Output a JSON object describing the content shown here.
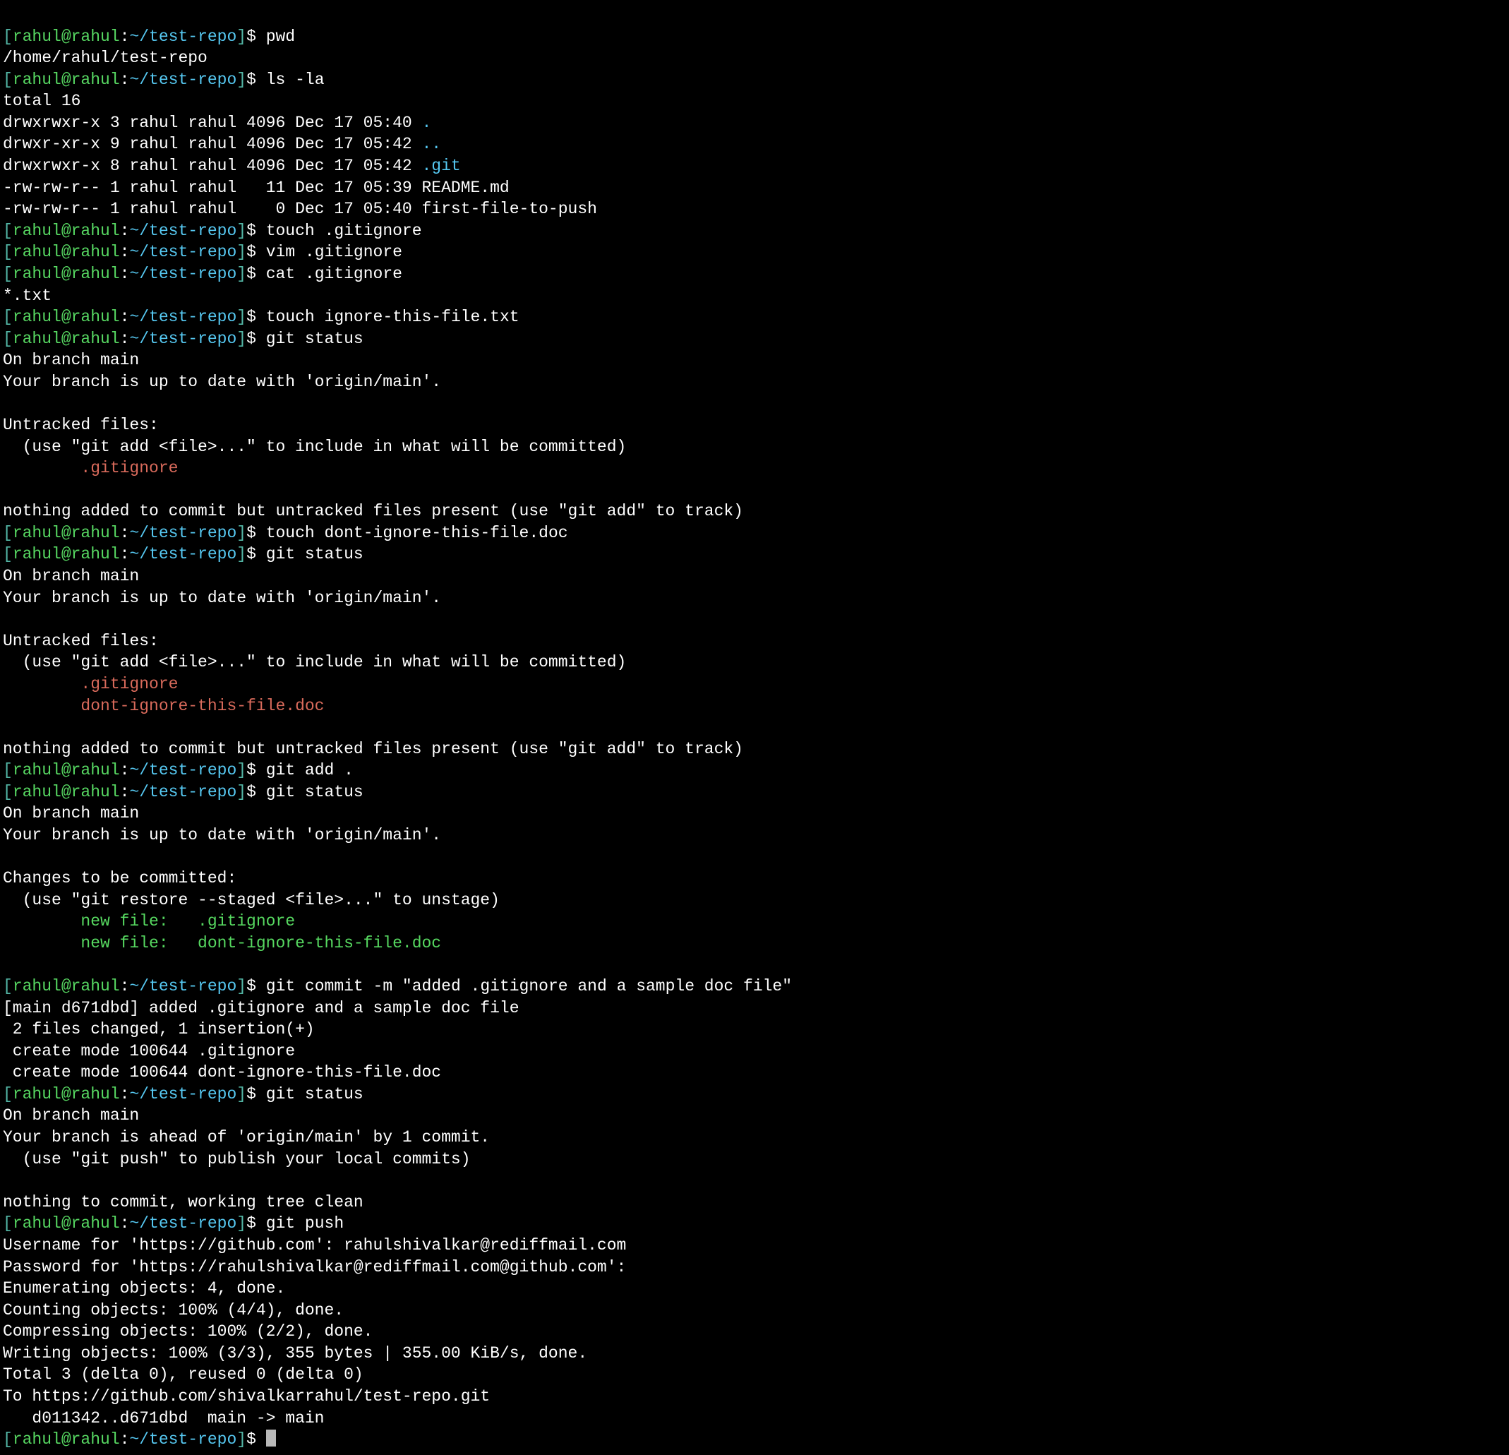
{
  "colors": {
    "bg": "#000000",
    "fg": "#ffffff",
    "user": "#57d862",
    "path": "#56c8f1",
    "red": "#d86a5b",
    "green": "#56d860",
    "teal": "#54b8a7"
  },
  "prompt": {
    "user": "rahul@rahul",
    "sep": ":",
    "path": "~/test-repo",
    "end": "$ ",
    "open_bracket": "[",
    "close_bracket": "]"
  },
  "lines": {
    "cmd_pwd": "pwd",
    "out_pwd": "/home/rahul/test-repo",
    "cmd_ls": "ls -la",
    "ls_total": "total 16",
    "ls_row1_a": "drwxrwxr-x 3 rahul rahul 4096 Dec 17 05:40 ",
    "ls_row1_b": ".",
    "ls_row2_a": "drwxr-xr-x 9 rahul rahul 4096 Dec 17 05:42 ",
    "ls_row2_b": "..",
    "ls_row3_a": "drwxrwxr-x 8 rahul rahul 4096 Dec 17 05:42 ",
    "ls_row3_b": ".git",
    "ls_row4": "-rw-rw-r-- 1 rahul rahul   11 Dec 17 05:39 README.md",
    "ls_row5": "-rw-rw-r-- 1 rahul rahul    0 Dec 17 05:40 first-file-to-push",
    "cmd_touch1": "touch .gitignore",
    "cmd_vim": "vim .gitignore",
    "cmd_cat": "cat .gitignore",
    "out_cat": "*.txt",
    "cmd_touch2": "touch ignore-this-file.txt",
    "cmd_status1": "git status",
    "st_branch": "On branch main",
    "st_uptodate": "Your branch is up to date with 'origin/main'.",
    "st_untracked_hdr": "Untracked files:",
    "st_untracked_hint": "  (use \"git add <file>...\" to include in what will be committed)",
    "st_untracked_f1": "        .gitignore",
    "st_nothing_added": "nothing added to commit but untracked files present (use \"git add\" to track)",
    "cmd_touch3": "touch dont-ignore-this-file.doc",
    "cmd_status2": "git status",
    "st_untracked_f2": "        dont-ignore-this-file.doc",
    "cmd_add": "git add .",
    "cmd_status3": "git status",
    "st_changes_hdr": "Changes to be committed:",
    "st_changes_hint": "  (use \"git restore --staged <file>...\" to unstage)",
    "st_newfile1": "        new file:   .gitignore",
    "st_newfile2": "        new file:   dont-ignore-this-file.doc",
    "cmd_commit": "git commit -m \"added .gitignore and a sample doc file\"",
    "commit_out1": "[main d671dbd] added .gitignore and a sample doc file",
    "commit_out2": " 2 files changed, 1 insertion(+)",
    "commit_out3": " create mode 100644 .gitignore",
    "commit_out4": " create mode 100644 dont-ignore-this-file.doc",
    "cmd_status4": "git status",
    "st_ahead": "Your branch is ahead of 'origin/main' by 1 commit.",
    "st_push_hint": "  (use \"git push\" to publish your local commits)",
    "st_clean": "nothing to commit, working tree clean",
    "cmd_push": "git push",
    "push_user": "Username for 'https://github.com': rahulshivalkar@rediffmail.com",
    "push_pass": "Password for 'https://rahulshivalkar@rediffmail.com@github.com': ",
    "push_enum": "Enumerating objects: 4, done.",
    "push_count": "Counting objects: 100% (4/4), done.",
    "push_compress": "Compressing objects: 100% (2/2), done.",
    "push_write": "Writing objects: 100% (3/3), 355 bytes | 355.00 KiB/s, done.",
    "push_total": "Total 3 (delta 0), reused 0 (delta 0)",
    "push_to": "To https://github.com/shivalkarrahul/test-repo.git",
    "push_refs": "   d011342..d671dbd  main -> main"
  }
}
